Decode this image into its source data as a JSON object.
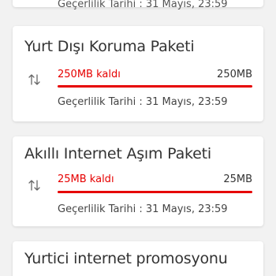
{
  "accent_color": "#e60000",
  "top_card": {
    "validity": "Geçerlilik Tarihi : 31 Mayıs, 23:59"
  },
  "packages": [
    {
      "title": "Yurt Dışı Koruma Paketi",
      "icon": "data-transfer-icon",
      "remaining": "250MB kaldı",
      "total": "250MB",
      "progress": 1.0,
      "validity": "Geçerlilik Tarihi : 31 Mayıs, 23:59"
    },
    {
      "title": "Akıllı Internet Aşım Paketi",
      "icon": "data-transfer-icon",
      "remaining": "25MB kaldı",
      "total": "25MB",
      "progress": 1.0,
      "validity": "Geçerlilik Tarihi : 31 Mayıs, 23:59"
    },
    {
      "title": "Yurtici internet promosyonu"
    }
  ]
}
